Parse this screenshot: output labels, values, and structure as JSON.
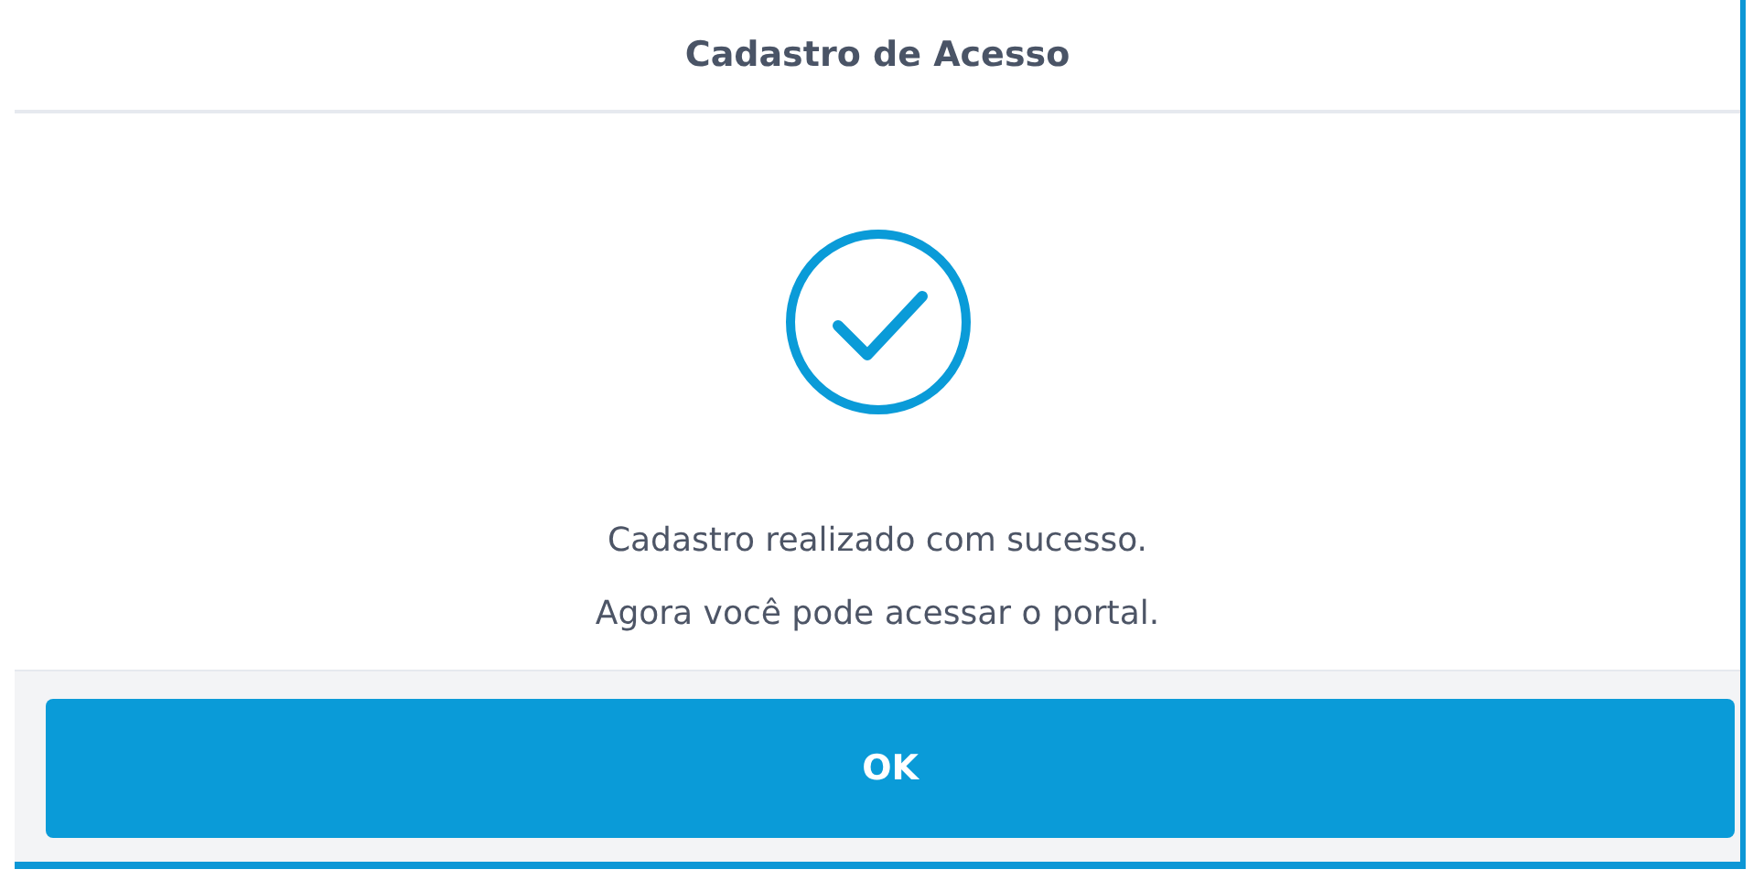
{
  "dialog": {
    "title": "Cadastro de Acesso",
    "message_lines": [
      "Cadastro realizado com sucesso.",
      "Agora você pode acessar o portal."
    ],
    "buttons": [
      {
        "label": "OK"
      }
    ]
  }
}
